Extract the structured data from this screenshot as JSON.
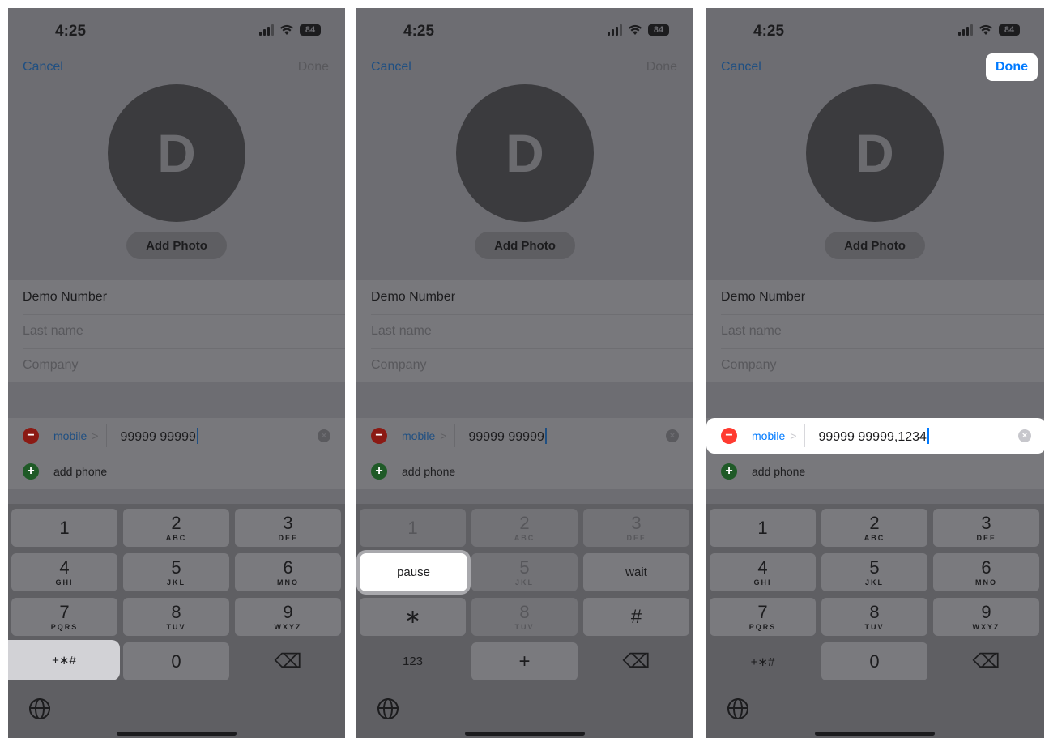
{
  "status": {
    "time": "4:25",
    "battery": "84"
  },
  "nav": {
    "cancel": "Cancel",
    "done": "Done"
  },
  "contact": {
    "initial": "D",
    "add_photo": "Add Photo",
    "first_name": "Demo Number",
    "last_name_placeholder": "Last name",
    "company_placeholder": "Company"
  },
  "phone_field": {
    "label": "mobile",
    "add_phone": "add phone"
  },
  "screens": [
    {
      "number": "99999 99999"
    },
    {
      "number": "99999 99999"
    },
    {
      "number": "99999 99999,1234"
    }
  ],
  "keypad": {
    "digits": [
      {
        "d": "1",
        "l": ""
      },
      {
        "d": "2",
        "l": "ABC"
      },
      {
        "d": "3",
        "l": "DEF"
      },
      {
        "d": "4",
        "l": "GHI"
      },
      {
        "d": "5",
        "l": "JKL"
      },
      {
        "d": "6",
        "l": "MNO"
      },
      {
        "d": "7",
        "l": "PQRS"
      },
      {
        "d": "8",
        "l": "TUV"
      },
      {
        "d": "9",
        "l": "WXYZ"
      }
    ],
    "symbols_key": "+∗#",
    "zero": "0",
    "pause": "pause",
    "wait": "wait",
    "star": "∗",
    "hash": "#",
    "num_key": "123",
    "plus": "+",
    "backspace": "⌫"
  },
  "colors": {
    "accent": "#007aff",
    "overlay": "#6d6d72",
    "delete_red": "#ff3b30"
  }
}
